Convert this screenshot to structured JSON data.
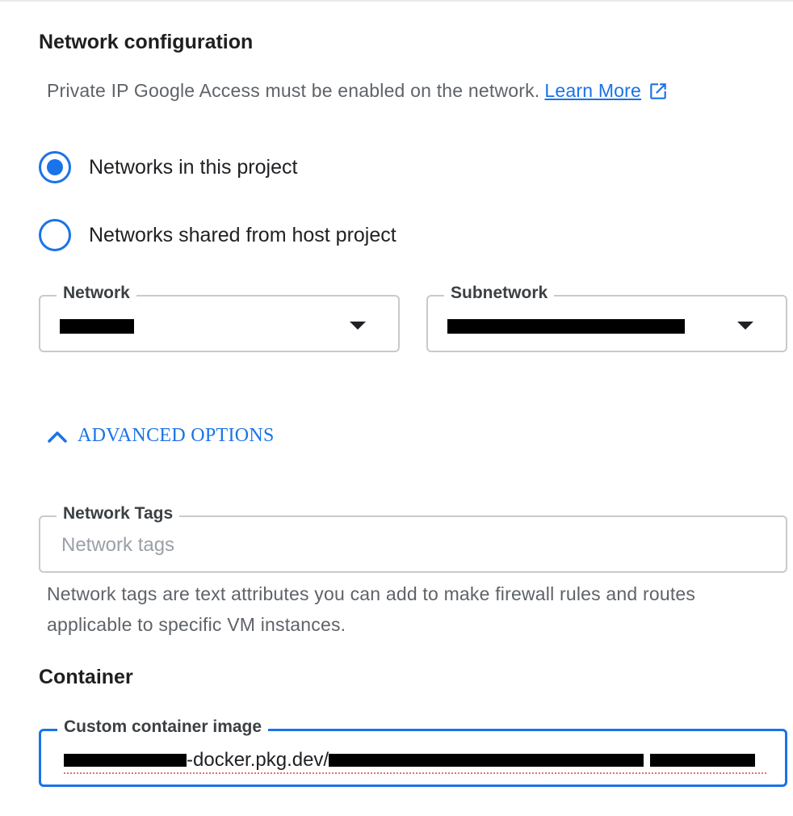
{
  "network_config": {
    "title": "Network configuration",
    "help_text": "Private IP Google Access must be enabled on the network.",
    "learn_more": "Learn More",
    "external_link_icon": "open-in-new-icon"
  },
  "network_choice": {
    "options": [
      {
        "label": "Networks in this project",
        "selected": true
      },
      {
        "label": "Networks shared from host project",
        "selected": false
      }
    ]
  },
  "network_select": {
    "label": "Network",
    "value_redacted": true
  },
  "subnetwork_select": {
    "label": "Subnetwork",
    "value_redacted": true
  },
  "advanced": {
    "label": "ADVANCED OPTIONS",
    "expanded": true
  },
  "network_tags": {
    "label": "Network Tags",
    "placeholder": "Network tags",
    "value": "",
    "help": "Network tags are text attributes you can add to make firewall rules and routes applicable to specific VM instances."
  },
  "container": {
    "title": "Container",
    "image_label": "Custom container image",
    "image_visible_parts": [
      "-docker.pkg.dev/"
    ]
  },
  "colors": {
    "accent": "#1a73e8",
    "border": "#c8cacc",
    "muted": "#5f6368"
  }
}
